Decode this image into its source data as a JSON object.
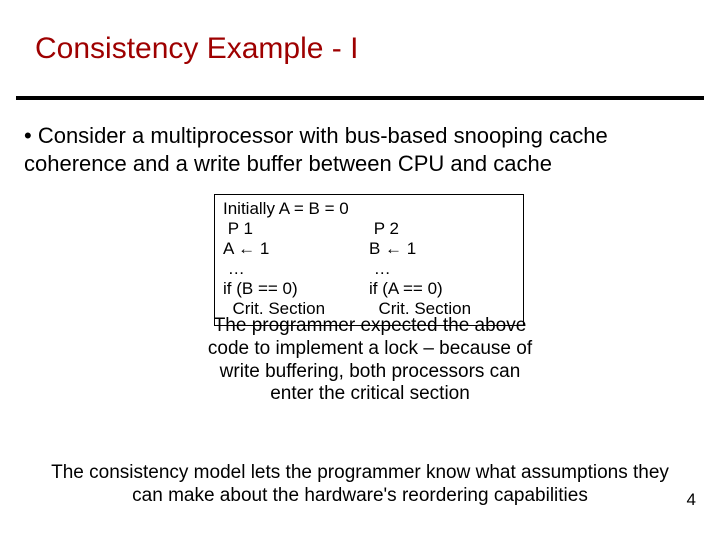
{
  "title": "Consistency Example - I",
  "bullet": {
    "marker": "•",
    "text": "Consider a multiprocessor with bus-based snooping cache coherence and a write buffer between CPU and cache"
  },
  "code": {
    "init": "Initially A = B = 0",
    "p1": {
      "name": " P 1",
      "assign": "A ← 1",
      "dots": " …",
      "cond": "if (B == 0)",
      "crit": "  Crit. Section"
    },
    "p2": {
      "name": " P 2",
      "assign": "B ← 1",
      "dots": " …",
      "cond": "if (A == 0)",
      "crit": "  Crit. Section"
    }
  },
  "explain": "The programmer expected the above code to implement a lock – because of write buffering, both processors can enter the critical section",
  "footer": "The consistency model lets the programmer know what assumptions they can make about the hardware's reordering capabilities",
  "pagenum": "4"
}
